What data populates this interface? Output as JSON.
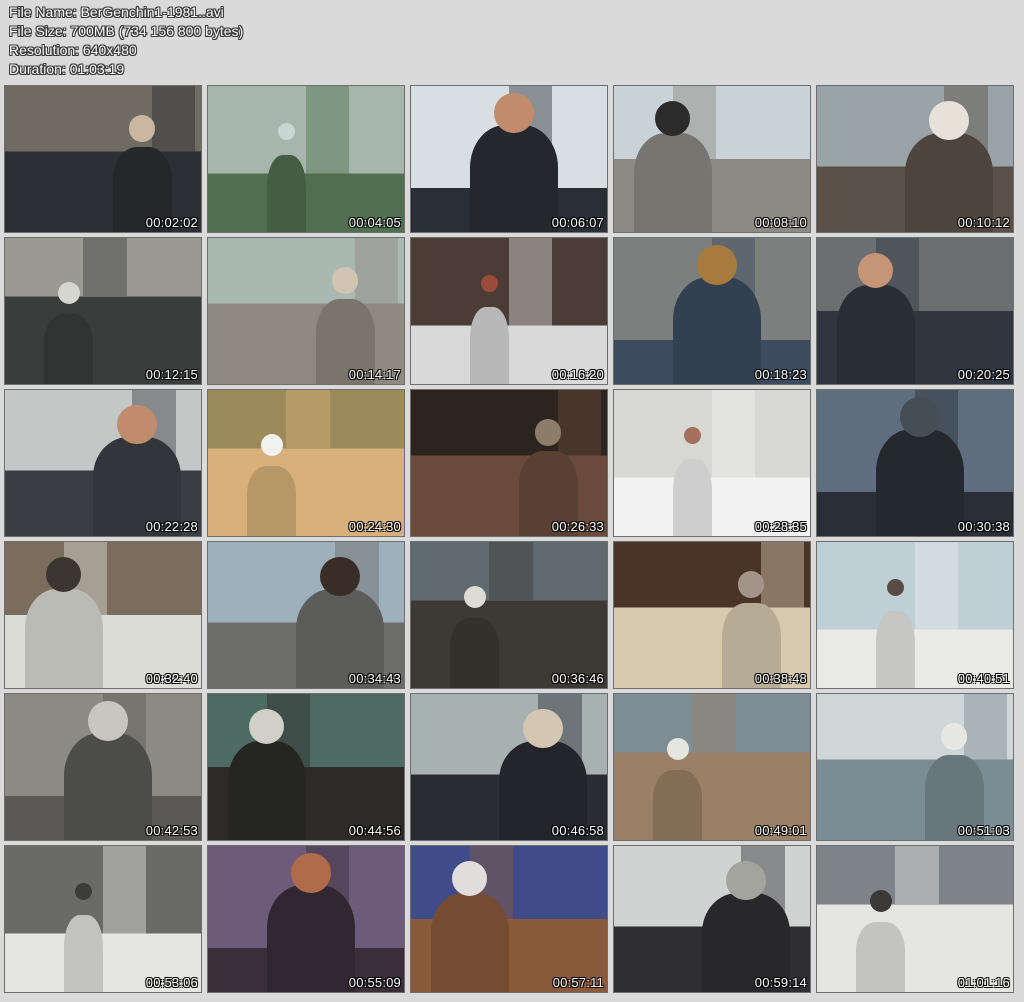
{
  "meta": {
    "file_name": "File Name: BerGenchin1-1981..avi",
    "file_size": "File Size: 700MB (734 156 800 bytes)",
    "resolution": "Resolution: 640x480",
    "duration": "Duration: 01:03:19"
  },
  "thumbnails": [
    {
      "time": "00:02:02",
      "palette": [
        "#6f6b62",
        "#2c2f33",
        "#c9b7a2"
      ]
    },
    {
      "time": "00:04:05",
      "palette": [
        "#a7b6ad",
        "#4f6f4f",
        "#c9d6d3"
      ]
    },
    {
      "time": "00:06:07",
      "palette": [
        "#d8dfe2",
        "#2a2e36",
        "#c28c6c"
      ]
    },
    {
      "time": "00:08:10",
      "palette": [
        "#c9d2d6",
        "#8c8a82",
        "#2b2b2b"
      ]
    },
    {
      "time": "00:10:12",
      "palette": [
        "#9aa3a8",
        "#5b5048",
        "#e6e2d9"
      ]
    },
    {
      "time": "00:12:15",
      "palette": [
        "#9a9a92",
        "#3b3c3c",
        "#d6d6d0"
      ]
    },
    {
      "time": "00:14:17",
      "palette": [
        "#a9b9b2",
        "#8e8a80",
        "#d2c4b2"
      ]
    },
    {
      "time": "00:16:20",
      "palette": [
        "#4b3d35",
        "#d9d9d9",
        "#9a4c3a"
      ]
    },
    {
      "time": "00:18:23",
      "palette": [
        "#7b7f7e",
        "#3c4b5e",
        "#a87a3d"
      ]
    },
    {
      "time": "00:20:25",
      "palette": [
        "#6b6f6f",
        "#2f3640",
        "#c69578"
      ]
    },
    {
      "time": "00:22:28",
      "palette": [
        "#c3c8c6",
        "#3b3f44",
        "#c18c6b"
      ]
    },
    {
      "time": "00:24:30",
      "palette": [
        "#9c8a5b",
        "#d7b07a",
        "#f1f1ee"
      ]
    },
    {
      "time": "00:26:33",
      "palette": [
        "#2c241f",
        "#6a4b3b",
        "#8c7d6a"
      ]
    },
    {
      "time": "00:28:35",
      "palette": [
        "#d7d7d3",
        "#f2f2f2",
        "#a46f5b"
      ]
    },
    {
      "time": "00:30:38",
      "palette": [
        "#5e6e7e",
        "#2a2f37",
        "#454d56"
      ]
    },
    {
      "time": "00:32:40",
      "palette": [
        "#7a6d5d",
        "#dcdcd6",
        "#3b3632"
      ]
    },
    {
      "time": "00:34:43",
      "palette": [
        "#9fb0bd",
        "#6c6c6a",
        "#3a2d27"
      ]
    },
    {
      "time": "00:36:46",
      "palette": [
        "#5f6a70",
        "#3d3a35",
        "#dcdcd4"
      ]
    },
    {
      "time": "00:38:48",
      "palette": [
        "#4a3327",
        "#d6c9ae",
        "#a3948a"
      ]
    },
    {
      "time": "00:40:51",
      "palette": [
        "#bfcfd6",
        "#e9e9e7",
        "#5a4b44"
      ]
    },
    {
      "time": "00:42:53",
      "palette": [
        "#8c8a82",
        "#5a5955",
        "#c8c6bf"
      ]
    },
    {
      "time": "00:44:56",
      "palette": [
        "#4d6a63",
        "#2c2b27",
        "#d0cfc8"
      ]
    },
    {
      "time": "00:46:58",
      "palette": [
        "#a7b1b2",
        "#2a2c31",
        "#d4c7b1"
      ]
    },
    {
      "time": "00:49:01",
      "palette": [
        "#7d8d95",
        "#9a8066",
        "#e6e6e1"
      ]
    },
    {
      "time": "00:51:03",
      "palette": [
        "#cfd6d8",
        "#7a8c94",
        "#e7e7e3"
      ]
    },
    {
      "time": "00:53:06",
      "palette": [
        "#6a6a66",
        "#e5e5e2",
        "#3c3c3a"
      ]
    },
    {
      "time": "00:55:09",
      "palette": [
        "#6e5a7a",
        "#3a2e38",
        "#b06b4a"
      ]
    },
    {
      "time": "00:57:11",
      "palette": [
        "#404b8a",
        "#8a5a3a",
        "#e2dede"
      ]
    },
    {
      "time": "00:59:14",
      "palette": [
        "#d1d3d2",
        "#2f2f33",
        "#a4a49f"
      ]
    },
    {
      "time": "01:01:16",
      "palette": [
        "#7d8388",
        "#e5e5e2",
        "#3b3a36"
      ]
    }
  ]
}
